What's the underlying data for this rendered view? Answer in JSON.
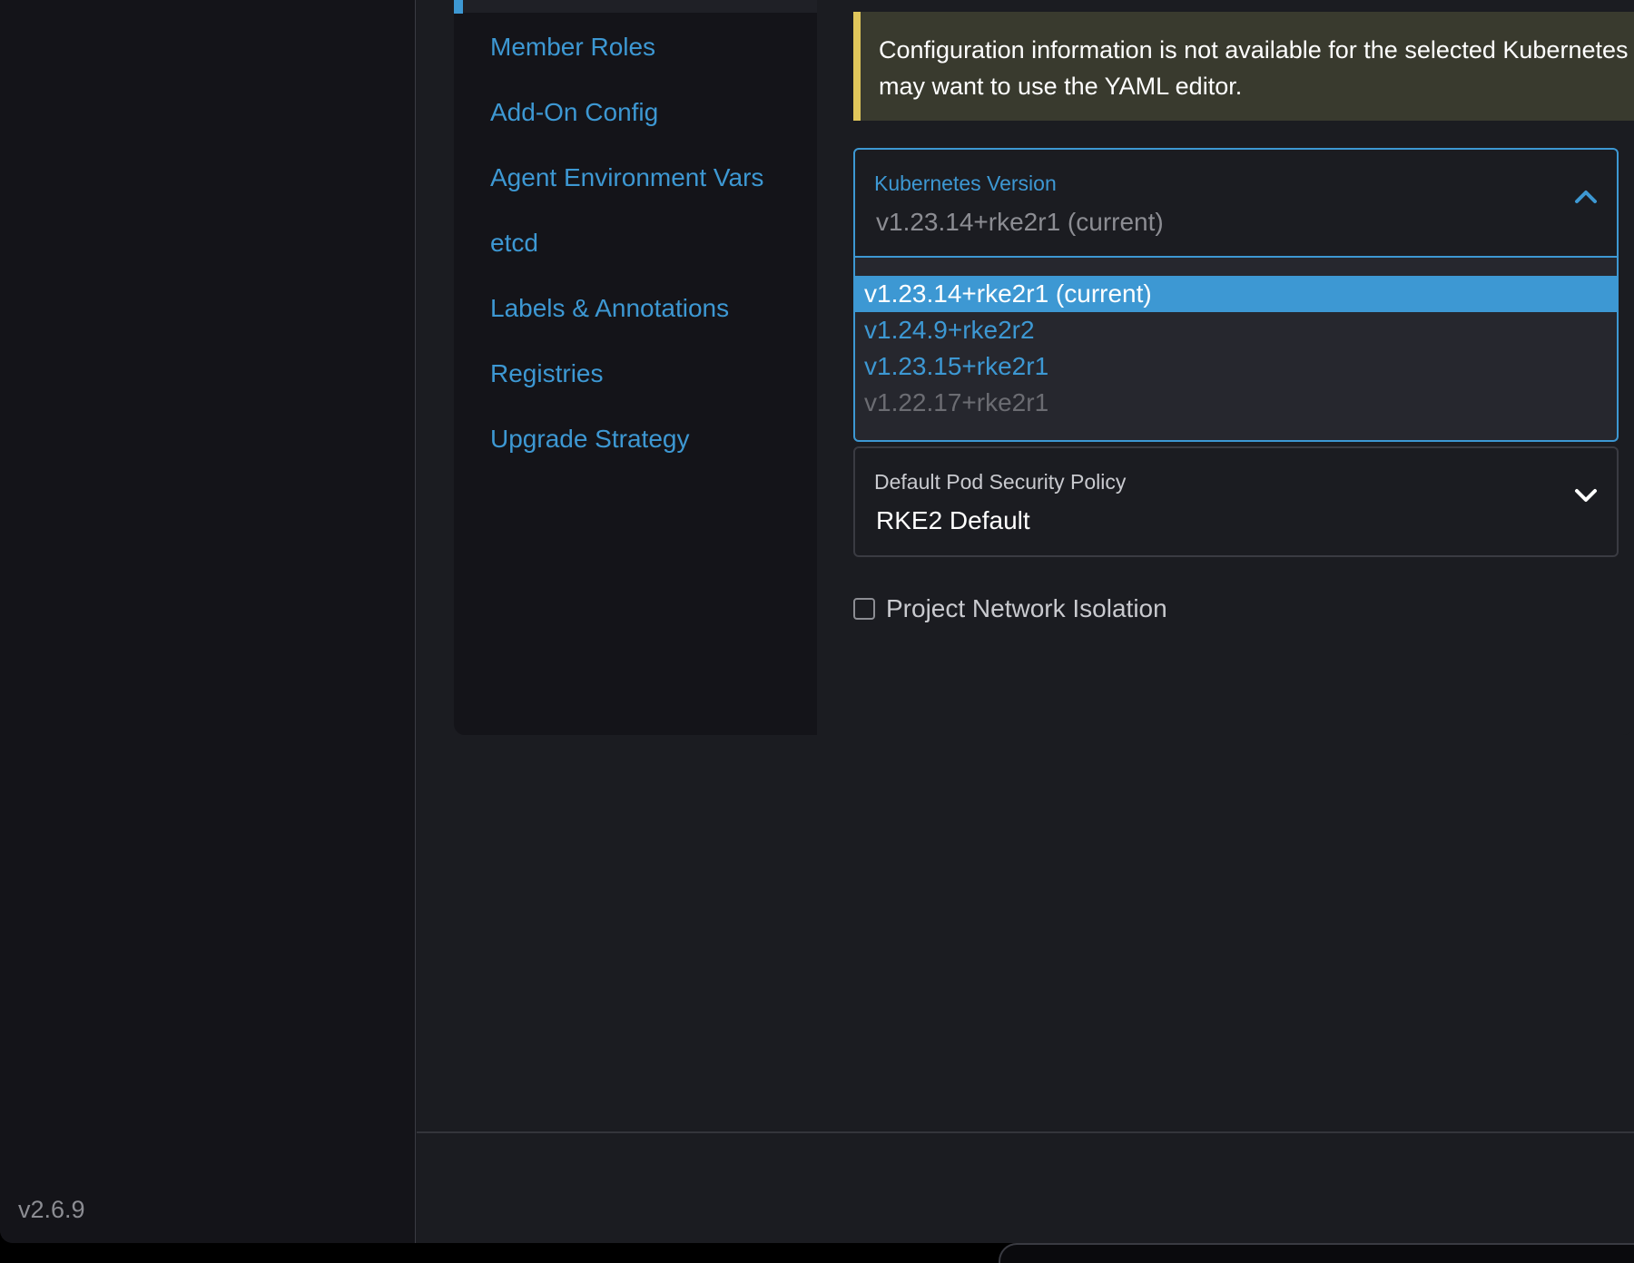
{
  "app": {
    "version": "v2.6.9"
  },
  "tabs": [
    {
      "label": "Member Roles"
    },
    {
      "label": "Add-On Config"
    },
    {
      "label": "Agent Environment Vars"
    },
    {
      "label": "etcd"
    },
    {
      "label": "Labels & Annotations"
    },
    {
      "label": "Registries"
    },
    {
      "label": "Upgrade Strategy"
    }
  ],
  "banner": {
    "line1": "Configuration information is not available for the selected Kubernetes version. You",
    "line2": "may want to use the YAML editor."
  },
  "kubernetes_version": {
    "label": "Kubernetes Version",
    "value": "v1.23.14+rke2r1 (current)",
    "expanded": true,
    "options": [
      {
        "label": "v1.23.14+rke2r1 (current)",
        "state": "selected"
      },
      {
        "label": "v1.24.9+rke2r2",
        "state": "normal"
      },
      {
        "label": "v1.23.15+rke2r1",
        "state": "normal"
      },
      {
        "label": "v1.22.17+rke2r1",
        "state": "disabled"
      }
    ]
  },
  "pod_security_policy": {
    "label": "Default Pod Security Policy",
    "value": "RKE2 Default"
  },
  "project_network_isolation": {
    "label": "Project Network Isolation",
    "checked": false
  },
  "colors": {
    "accent": "#3d98d3",
    "warning_border": "#e0c65b",
    "warning_bg": "#393a2e",
    "background": "#1b1c21",
    "sidebar_bg": "#141419"
  }
}
